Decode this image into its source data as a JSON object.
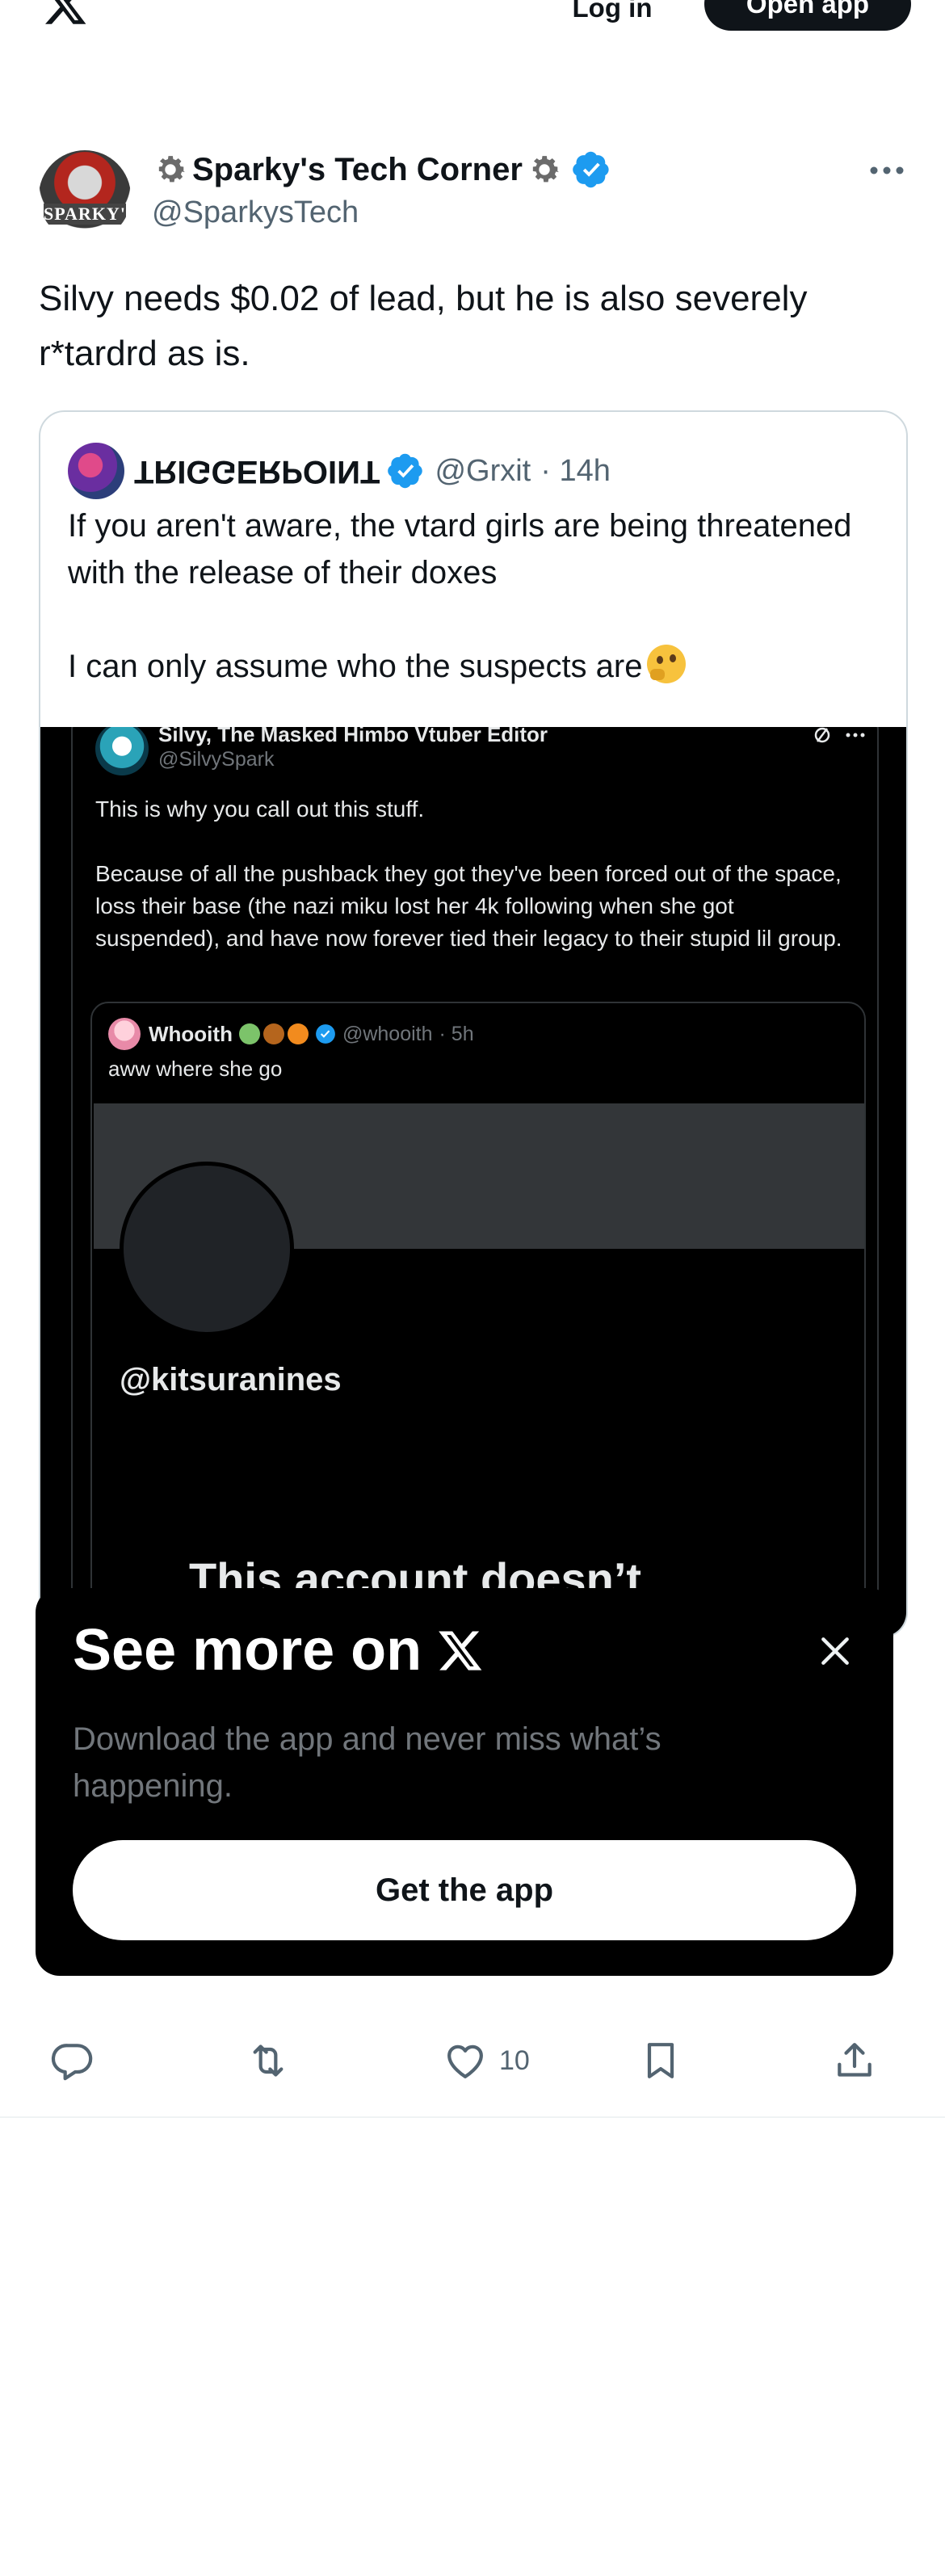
{
  "topbar": {
    "login_label": "Log in",
    "open_app_label": "Open app",
    "logo_icon": "x-logo-icon"
  },
  "post": {
    "author_name": "Sparky's Tech Corner",
    "author_handle": "@SparkysTech",
    "avatar_text": "SPARKY'S",
    "text": "Silvy needs $0.02 of lead, but he is also severely r*tardrd as is.",
    "like_count": "10"
  },
  "quote": {
    "name": "TRIGGERPOINT",
    "handle": "@Grxit",
    "time": "· 14h",
    "text": "If you aren't aware, the vtard girls are being threatened with the release of their doxes\n\nI can only assume who the suspects are"
  },
  "screenshot": {
    "name": "Silvy, The Masked Himbo Vtuber Editor",
    "handle": "@SilvySpark",
    "body": "This is why you call out this stuff.\n\nBecause of all the pushback they got they've been forced out of the space, loss their base (the nazi miku lost her 4k following when she got suspended), and have now forever tied their legacy to their stupid lil group.",
    "inner": {
      "name": "Whooith",
      "handle": "@whooith",
      "time": "· 5h",
      "text": "aww where she go",
      "profile_handle": "@kitsuranines",
      "missing_text": "This account doesn’t"
    }
  },
  "overlay": {
    "title": "See more on",
    "description": "Download the app and never miss what’s happening.",
    "button_label": "Get the app"
  },
  "colors": {
    "verified": "#1d9bf0",
    "text_primary": "#0f1419",
    "text_secondary": "#536471",
    "border": "#cfd9de"
  }
}
